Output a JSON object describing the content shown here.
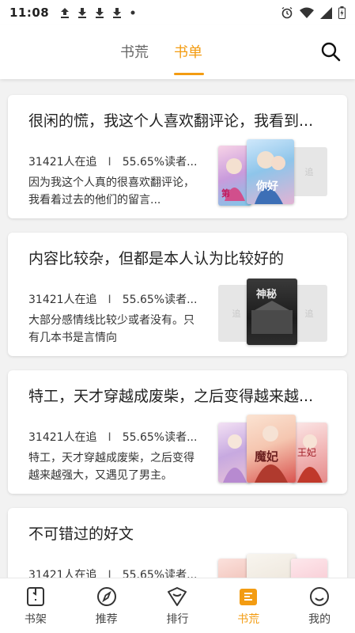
{
  "status_bar": {
    "time": "11:08",
    "left_icons": [
      "upload-icon",
      "download-icon",
      "download-icon",
      "download-icon",
      "dot-icon"
    ],
    "right_icons": [
      "alarm-icon",
      "wifi-icon",
      "signal-icon",
      "battery-icon"
    ]
  },
  "header": {
    "tabs": [
      {
        "label": "书荒",
        "active": false
      },
      {
        "label": "书单",
        "active": true
      }
    ],
    "accent_color": "#f39c12"
  },
  "cards": [
    {
      "title": "很闲的慌，我这个人喜欢翻评论，我看到...",
      "followers": "31421人在追",
      "readers": "55.65%读者...",
      "desc": "因为我这个人真的很喜欢翻评论，我看着过去的他们的留言..."
    },
    {
      "title": "内容比较杂，但都是本人认为比较好的",
      "followers": "31421人在追",
      "readers": "55.65%读者...",
      "desc": "大部分感情线比较少或者没有。只有几本书是言情向"
    },
    {
      "title": "特工，天才穿越成废柴，之后变得越来越...",
      "followers": "31421人在追",
      "readers": "55.65%读者...",
      "desc": "特工，天才穿越成废柴，之后变得越来越强大，又遇见了男主。"
    },
    {
      "title": "不可错过的好文",
      "followers": "31421人在追",
      "readers": "55.65%读者...",
      "desc": ""
    }
  ],
  "bottom_nav": [
    {
      "label": "书架",
      "icon": "bookshelf-icon",
      "active": false
    },
    {
      "label": "推荐",
      "icon": "compass-icon",
      "active": false
    },
    {
      "label": "排行",
      "icon": "ranking-icon",
      "active": false
    },
    {
      "label": "书荒",
      "icon": "book-shortage-icon",
      "active": true
    },
    {
      "label": "我的",
      "icon": "profile-icon",
      "active": false
    }
  ]
}
